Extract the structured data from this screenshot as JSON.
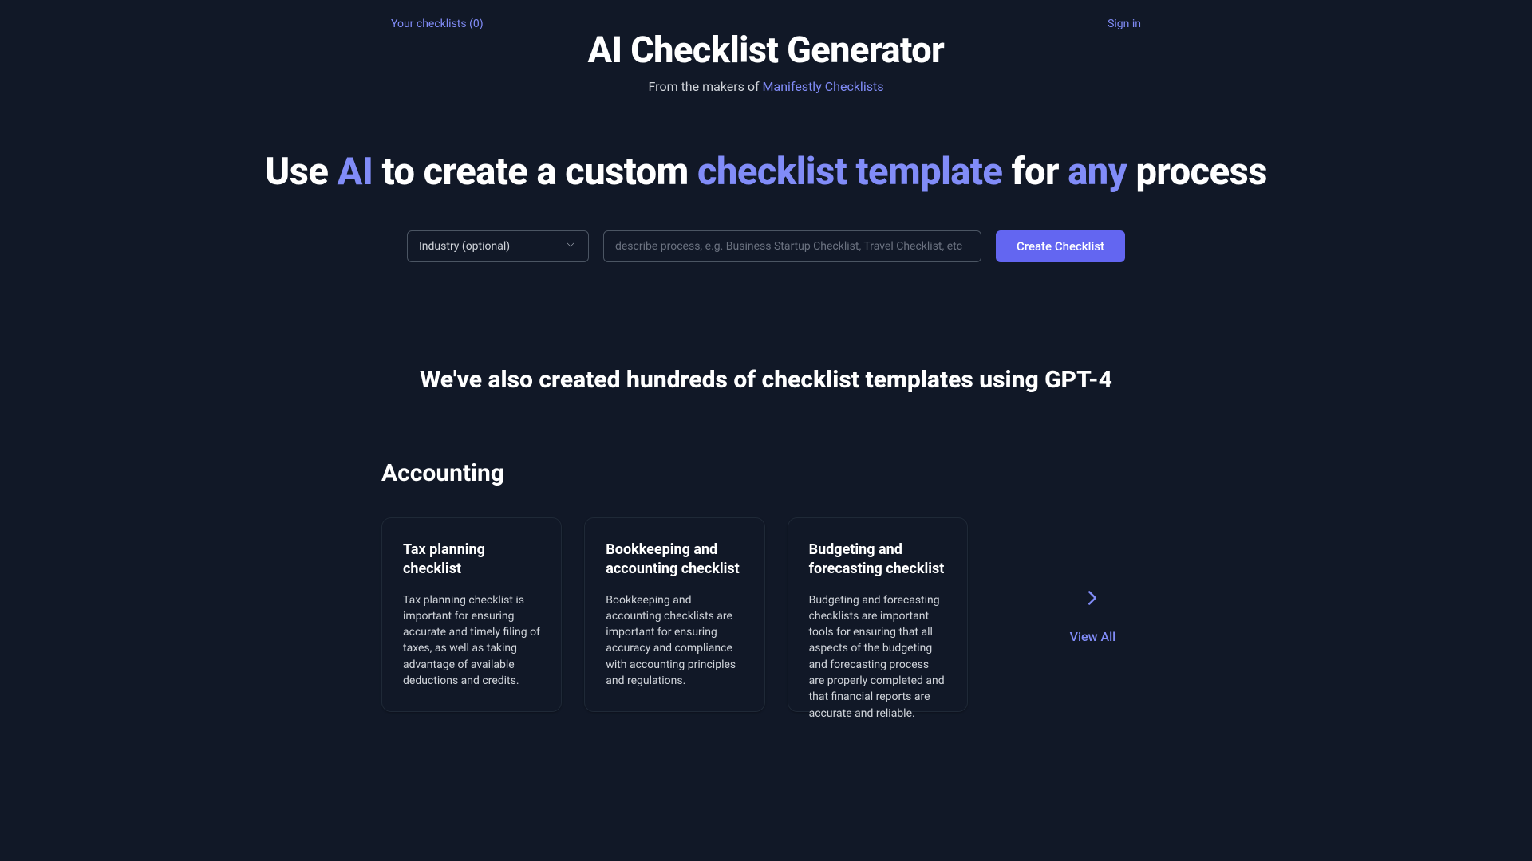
{
  "top_nav": {
    "left_link": "Your checklists (0)",
    "right_link": "Sign in"
  },
  "header": {
    "title": "AI Checklist Generator",
    "subtitle_prefix": "From the makers of ",
    "subtitle_link": "Manifestly Checklists"
  },
  "headline": {
    "p1": "Use ",
    "p2": "AI",
    "p3": " to create a custom ",
    "p4": "checklist template",
    "p5": " for ",
    "p6": "any",
    "p7": " process"
  },
  "form": {
    "industry_selected": "Industry (optional)",
    "process_placeholder": "describe process, e.g. Business Startup Checklist, Travel Checklist, etc",
    "create_label": "Create Checklist"
  },
  "templates_headline": "We've also created hundreds of checklist templates using GPT-4",
  "category": {
    "title": "Accounting",
    "view_all_label": "View All",
    "cards": [
      {
        "title": "Tax planning checklist",
        "desc": "Tax planning checklist is important for ensuring accurate and timely filing of taxes, as well as taking advantage of available deductions and credits."
      },
      {
        "title": "Bookkeeping and accounting checklist",
        "desc": "Bookkeeping and accounting checklists are important for ensuring accuracy and compliance with accounting principles and regulations."
      },
      {
        "title": "Budgeting and forecasting checklist",
        "desc": "Budgeting and forecasting checklists are important tools for ensuring that all aspects of the budgeting and forecasting process are properly completed and that financial reports are accurate and reliable."
      }
    ]
  }
}
